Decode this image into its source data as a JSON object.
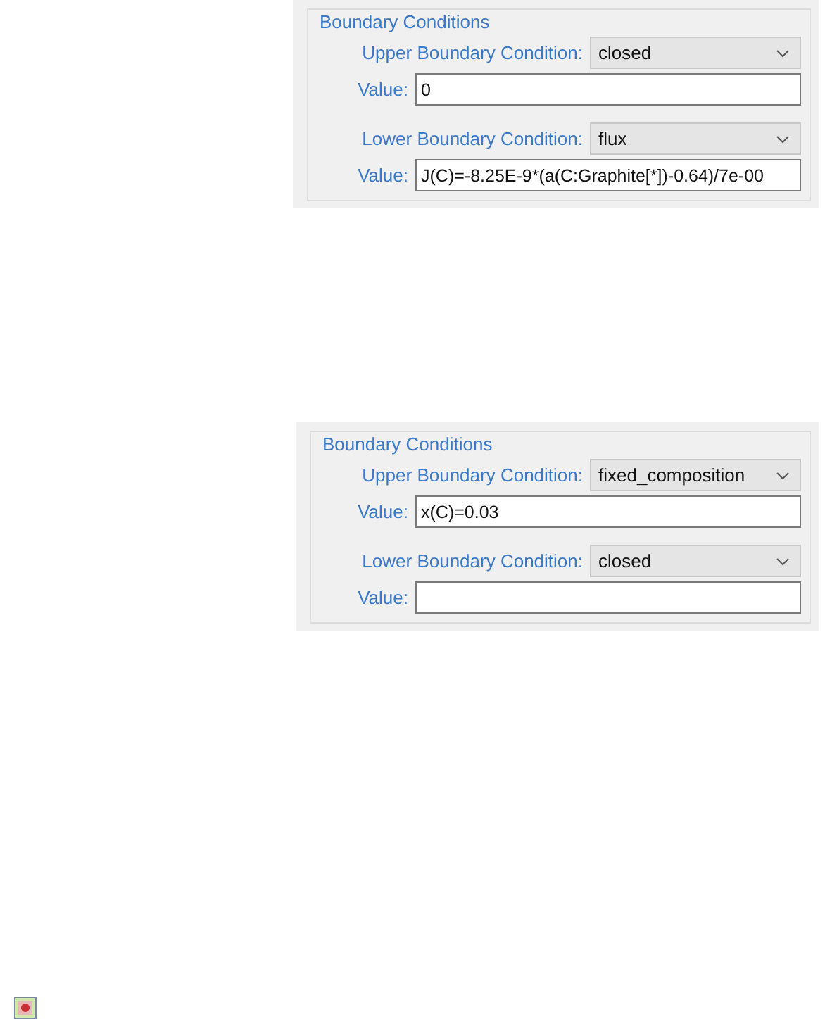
{
  "panels": [
    {
      "title": "Boundary Conditions",
      "rows": [
        {
          "kind": "dropdown",
          "label": "Upper Boundary Condition:",
          "value": "closed"
        },
        {
          "kind": "text",
          "label": "Value:",
          "value": "0"
        },
        {
          "kind": "dropdown",
          "label": "Lower Boundary Condition:",
          "value": "flux"
        },
        {
          "kind": "text",
          "label": "Value:",
          "value": "J(C)=-8.25E-9*(a(C:Graphite[*])-0.64)/7e-00"
        }
      ]
    },
    {
      "title": "Boundary Conditions",
      "rows": [
        {
          "kind": "dropdown",
          "label": "Upper Boundary Condition:",
          "value": "fixed_composition"
        },
        {
          "kind": "text",
          "label": "Value:",
          "value": "x(C)=0.03"
        },
        {
          "kind": "dropdown",
          "label": "Lower Boundary Condition:",
          "value": "closed"
        },
        {
          "kind": "text",
          "label": "Value:"
        }
      ]
    }
  ]
}
